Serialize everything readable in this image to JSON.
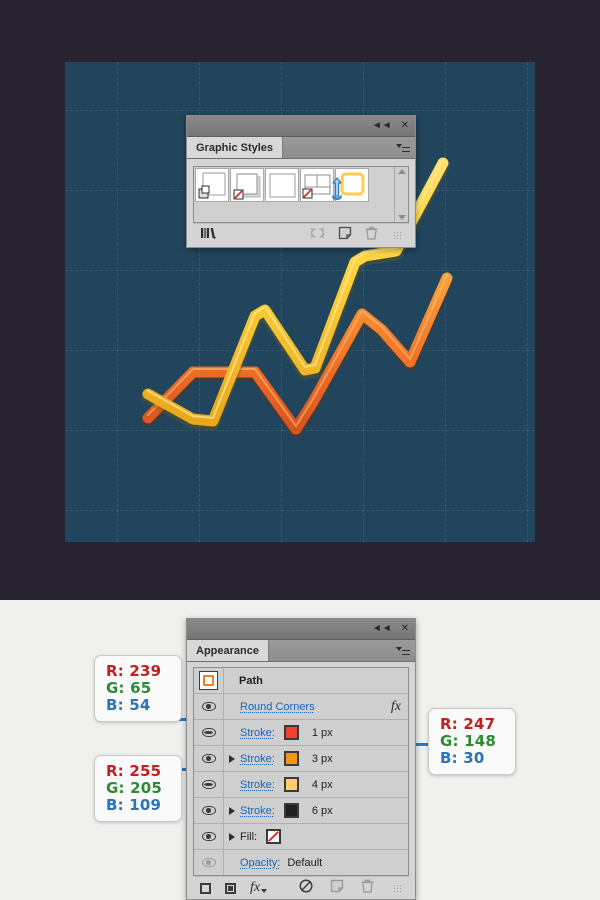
{
  "canvas": {
    "dark_background": "#272430",
    "light_background": "#f0f0ee",
    "artboard_color": "#21455c"
  },
  "graphic_styles_panel": {
    "title": "Graphic Styles",
    "titlebar_icons": [
      "collapse-icon",
      "close-icon"
    ],
    "menu_icon": "panel-menu-icon",
    "swatches": [
      {
        "name": "style-swatch-1",
        "icon": "duplicate-squares-icon",
        "selected": false
      },
      {
        "name": "style-swatch-2",
        "icon": "square-with-no-fill-icon",
        "selected": false
      },
      {
        "name": "style-swatch-3",
        "icon": "plain-square-icon",
        "selected": false
      },
      {
        "name": "style-swatch-4",
        "icon": "split-square-no-fill-icon",
        "selected": false
      },
      {
        "name": "style-swatch-5",
        "icon": "yellow-rounded-square-icon",
        "selected": true,
        "color": "#ffcd4d"
      }
    ],
    "footer_icons": [
      "styles-library-menu-icon",
      "break-link-to-style-icon",
      "new-graphic-style-icon",
      "delete-graphic-style-icon"
    ],
    "scrollbar": {
      "up": "scroll-up-arrow",
      "down": "scroll-down-arrow"
    },
    "cursor": "hand-pointer-cursor"
  },
  "appearance_panel": {
    "title": "Appearance",
    "titlebar_icons": [
      "collapse-icon",
      "close-icon"
    ],
    "menu_icon": "panel-menu-icon",
    "object_row": {
      "icon": "path-thumbnail-icon",
      "label": "Path"
    },
    "rows": [
      {
        "type": "effect",
        "visible": true,
        "expandable": false,
        "label": "Round Corners",
        "value": "",
        "swatch": null,
        "fx": "fx"
      },
      {
        "type": "stroke",
        "visible": true,
        "expandable": false,
        "label": "Stroke:",
        "value": "1 px",
        "swatch": "#ef4136",
        "fx": ""
      },
      {
        "type": "stroke",
        "visible": true,
        "expandable": true,
        "label": "Stroke:",
        "value": "3 px",
        "swatch": "#f7941e",
        "fx": ""
      },
      {
        "type": "stroke",
        "visible": true,
        "expandable": false,
        "label": "Stroke:",
        "value": "4 px",
        "swatch": "#ffcd6d",
        "fx": ""
      },
      {
        "type": "stroke",
        "visible": true,
        "expandable": true,
        "label": "Stroke:",
        "value": "6 px",
        "swatch": "#231f20",
        "fx": ""
      },
      {
        "type": "fill",
        "visible": true,
        "expandable": true,
        "label": "Fill:",
        "value": "",
        "swatch": "none",
        "fx": ""
      },
      {
        "type": "opacity",
        "visible": false,
        "expandable": false,
        "label": "Opacity:",
        "value": "Default",
        "swatch": null,
        "fx": ""
      }
    ],
    "footer_icons": [
      "add-new-stroke-icon",
      "add-new-fill-icon",
      "add-effect-icon",
      "clear-appearance-icon",
      "duplicate-item-icon",
      "delete-item-icon"
    ]
  },
  "callouts": [
    {
      "name": "callout-red",
      "r": "R: 239",
      "g": "G: 65",
      "b": "B: 54",
      "hex": "#ef4136"
    },
    {
      "name": "callout-lightyellow",
      "r": "R: 255",
      "g": "G: 205",
      "b": "B: 109",
      "hex": "#ffcd6d"
    },
    {
      "name": "callout-orange",
      "r": "R: 247",
      "g": "G: 148",
      "b": "B: 30",
      "hex": "#f7941e"
    }
  ],
  "artwork": {
    "description": "Two stylized zig-zag line graphs on a dark blue artboard with dashed grid",
    "line_yellow_color": "#ffd13b",
    "line_orange_color": "#f26a2b",
    "grid_color": "rgba(255,255,255,0.10)"
  }
}
